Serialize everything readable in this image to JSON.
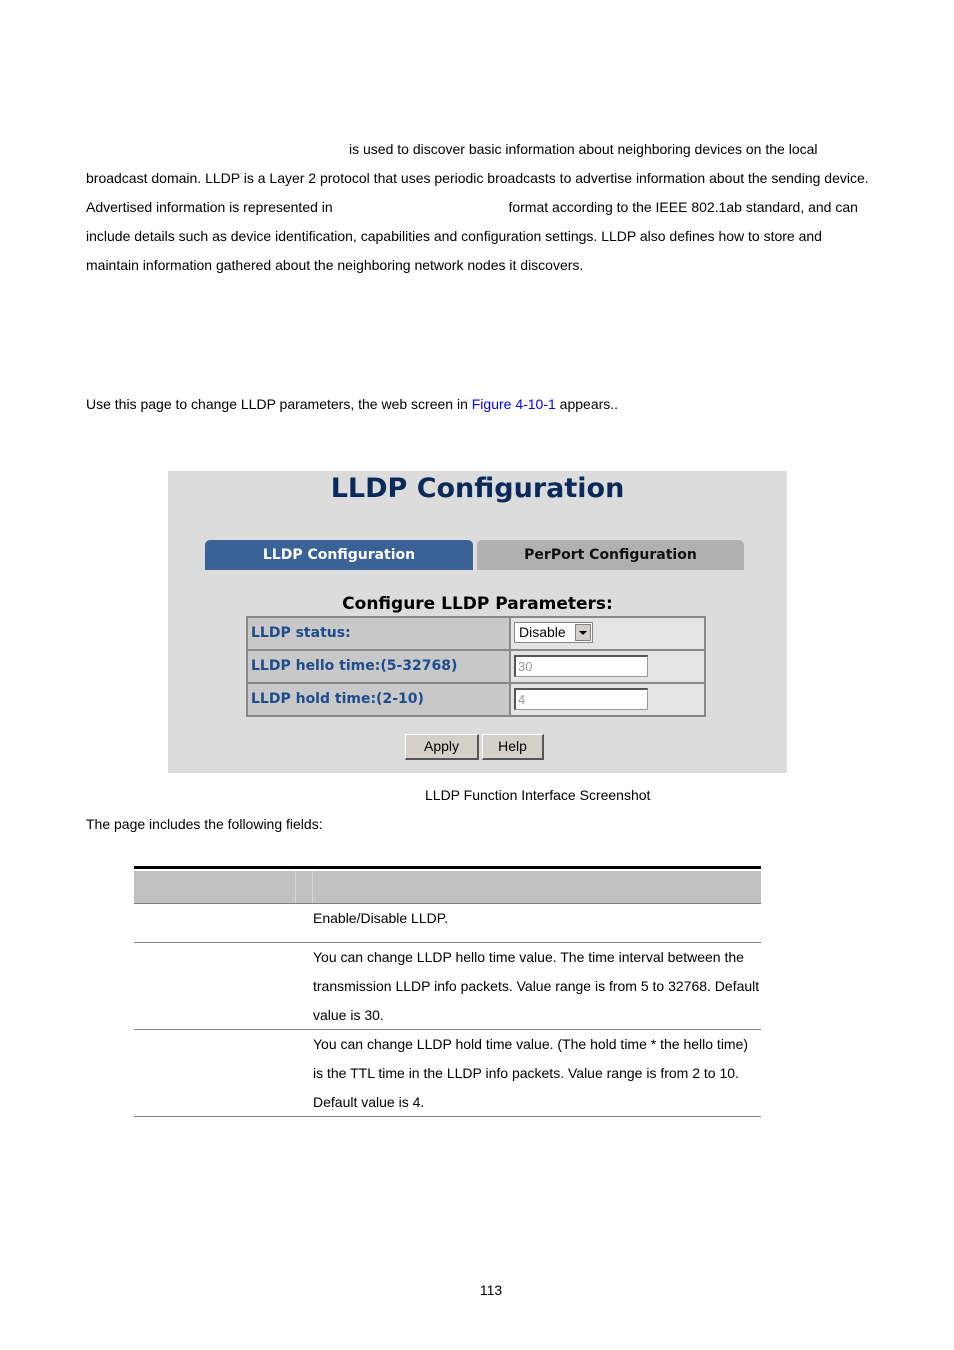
{
  "intro": {
    "part1": "is used to discover basic information about neighboring devices on the local broadcast domain. LLDP is a Layer 2 protocol that uses periodic broadcasts to advertise information about the sending device. Advertised information is represented in",
    "part2": "format according to the IEEE 802.1ab standard, and can include details such as device identification, capabilities and configuration settings. LLDP also defines how to store and maintain information gathered about the neighboring network nodes it discovers."
  },
  "use_page": {
    "before": "Use this page to change LLDP parameters, the web screen in ",
    "link": "Figure 4-10-1",
    "after": " appears.."
  },
  "figure": {
    "title": "LLDP Configuration",
    "tabs": [
      {
        "label": "LLDP Configuration",
        "active": true
      },
      {
        "label": "PerPort Configuration",
        "active": false
      }
    ],
    "params_title": "Configure LLDP Parameters:",
    "rows": [
      {
        "label": "LLDP status:",
        "type": "select",
        "value": "Disable"
      },
      {
        "label": "LLDP hello time:(5-32768)",
        "type": "text",
        "value": "30"
      },
      {
        "label": "LLDP hold time:(2-10)",
        "type": "text",
        "value": "4"
      }
    ],
    "buttons": {
      "apply": "Apply",
      "help": "Help"
    },
    "colors": {
      "tab_active": "#3a6296",
      "tab_inactive": "#b0b0b0",
      "label_text": "#1d4c8c",
      "title_text": "#0a2a5c"
    }
  },
  "caption": "LLDP Function Interface Screenshot",
  "fields_intro": "The page includes the following fields:",
  "desc_table": {
    "rows": [
      {
        "description": "Enable/Disable LLDP."
      },
      {
        "description": "You can change LLDP hello time value. The time interval between the transmission LLDP info packets. Value range is from 5 to 32768. Default value is 30."
      },
      {
        "description": "You can change LLDP hold time value. (The hold time * the hello time) is the TTL time in the LLDP info packets. Value range is from 2 to 10. Default value is 4."
      }
    ]
  },
  "page_number": "113"
}
